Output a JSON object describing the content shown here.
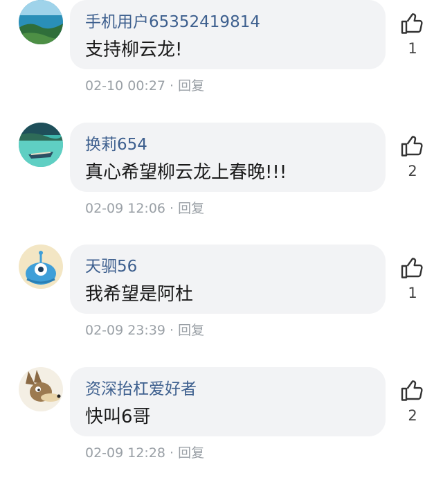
{
  "comments": [
    {
      "user": "手机用户65352419814",
      "text": "支持柳云龙!",
      "time": "02-10 00:27",
      "sep": " · ",
      "reply": "回复",
      "likes": "1",
      "avatar_icon": "sea-coast-avatar"
    },
    {
      "user": "换莉654",
      "text": "真心希望柳云龙上春晚!!!",
      "time": "02-09 12:06",
      "sep": " · ",
      "reply": "回复",
      "likes": "2",
      "avatar_icon": "boat-avatar"
    },
    {
      "user": "天驷56",
      "text": "我希望是阿杜",
      "time": "02-09 23:39",
      "sep": " · ",
      "reply": "回复",
      "likes": "1",
      "avatar_icon": "cartoon-robot-avatar"
    },
    {
      "user": "资深抬杠爱好者",
      "text": "快叫6哥",
      "time": "02-09 12:28",
      "sep": " · ",
      "reply": "回复",
      "likes": "2",
      "avatar_icon": "coyote-avatar"
    }
  ],
  "colors": {
    "username": "#3d5f8e",
    "bubble": "#f2f3f5",
    "meta": "#9aa0a6"
  },
  "icons": {
    "like": "thumbs-up-icon"
  }
}
